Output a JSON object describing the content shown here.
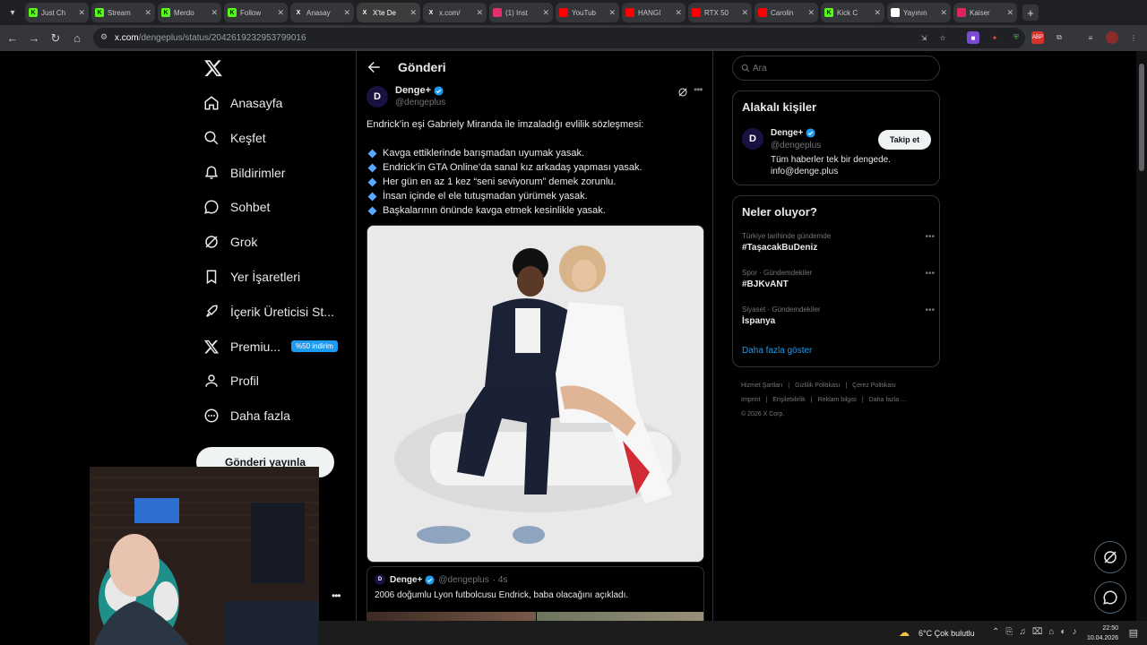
{
  "browser": {
    "tabs": [
      {
        "title": "Just Ch",
        "favicon": "kick-icon",
        "color": "#53fc18"
      },
      {
        "title": "Stream",
        "favicon": "kick-icon",
        "color": "#53fc18"
      },
      {
        "title": "Merdo",
        "favicon": "kick-icon",
        "color": "#53fc18"
      },
      {
        "title": "Follow",
        "favicon": "kick-icon",
        "color": "#53fc18"
      },
      {
        "title": "Anasay",
        "favicon": "x-icon",
        "color": "#ffffff"
      },
      {
        "title": "X'te De",
        "favicon": "x-icon",
        "color": "#ffffff"
      },
      {
        "title": "x.com/",
        "favicon": "x-icon",
        "color": "#ffffff"
      },
      {
        "title": "(1) Inst",
        "favicon": "instagram-icon",
        "color": "#e1306c"
      },
      {
        "title": "YouTub",
        "favicon": "youtube-icon",
        "color": "#ff0000"
      },
      {
        "title": "HANGI",
        "favicon": "youtube-icon",
        "color": "#ff0000"
      },
      {
        "title": "RTX 50",
        "favicon": "youtube-icon",
        "color": "#ff0000"
      },
      {
        "title": "Carolin",
        "favicon": "youtube-icon",
        "color": "#ff0000"
      },
      {
        "title": "Kick C",
        "favicon": "kick-icon",
        "color": "#53fc18"
      },
      {
        "title": "Yayının",
        "favicon": "app-icon",
        "color": "#ffffff"
      },
      {
        "title": "Kaiser",
        "favicon": "media-icon",
        "color": "#e0245e"
      }
    ],
    "url_host": "x.com",
    "url_path": "/dengeplus/status/2042619232953799016"
  },
  "leftnav": {
    "items": [
      {
        "label": "Anasayfa",
        "icon": "home-icon"
      },
      {
        "label": "Keşfet",
        "icon": "search-icon"
      },
      {
        "label": "Bildirimler",
        "icon": "bell-icon"
      },
      {
        "label": "Sohbet",
        "icon": "chat-icon"
      },
      {
        "label": "Grok",
        "icon": "grok-icon"
      },
      {
        "label": "Yer İşaretleri",
        "icon": "bookmark-icon"
      },
      {
        "label": "İçerik Üreticisi St...",
        "icon": "rocket-icon"
      },
      {
        "label": "Premiu...",
        "icon": "x-icon",
        "badge": "%50 indirim"
      },
      {
        "label": "Profil",
        "icon": "person-icon"
      },
      {
        "label": "Daha fazla",
        "icon": "more-circle-icon"
      }
    ],
    "post_button": "Gönderi yayınla"
  },
  "main": {
    "title": "Gönderi",
    "author": {
      "name": "Denge+",
      "handle": "@dengeplus",
      "avatar": "D"
    },
    "intro": "Endrick’in eşi Gabriely Miranda ile imzaladığı evlilik sözleşmesi:",
    "bullets": [
      "Kavga ettiklerinde barışmadan uyumak yasak.",
      "Endrick’in GTA Online’da sanal kız arkadaş yapması yasak.",
      "Her gün en az 1 kez “seni seviyorum” demek zorunlu.",
      "İnsan içinde el ele tutuşmadan yürümek yasak.",
      "Başkalarının önünde kavga etmek kesinlikle yasak."
    ],
    "quote": {
      "name": "Denge+",
      "handle": "@dengeplus",
      "time": "· 4s",
      "text": "2006 doğumlu Lyon futbolcusu Endrick, baba olacağını açıkladı."
    }
  },
  "right": {
    "search_placeholder": "Ara",
    "related": {
      "title": "Alakalı kişiler",
      "name": "Denge+",
      "handle": "@dengeplus",
      "bio_line1": "Tüm haberler tek bir dengede.",
      "bio_line2": "info@denge.plus",
      "follow": "Takip et"
    },
    "trends": {
      "title": "Neler oluyor?",
      "items": [
        {
          "meta": "Türkiye tarihinde gündemde",
          "name": "#TaşacakBuDeniz"
        },
        {
          "meta": "Spor · Gündemdekiler",
          "name": "#BJKvANT"
        },
        {
          "meta": "Siyaset · Gündemdekiler",
          "name": "İspanya"
        }
      ],
      "show_more": "Daha fazla göster"
    },
    "footer": {
      "links": [
        "Hizmet Şartları",
        "Gizlilik Politikası",
        "Çerez Politikası",
        "Imprint",
        "Erişilebilirlik",
        "Reklam bilgisi",
        "Daha fazla ..."
      ],
      "copyright": "© 2026 X Corp."
    }
  },
  "taskbar": {
    "weather": "6°C  Çok bulutlu",
    "time": "22:50",
    "date": "10.04.2026"
  },
  "colors": {
    "accent": "#1d9bf0",
    "bg": "#000000",
    "border": "#2f3336"
  }
}
